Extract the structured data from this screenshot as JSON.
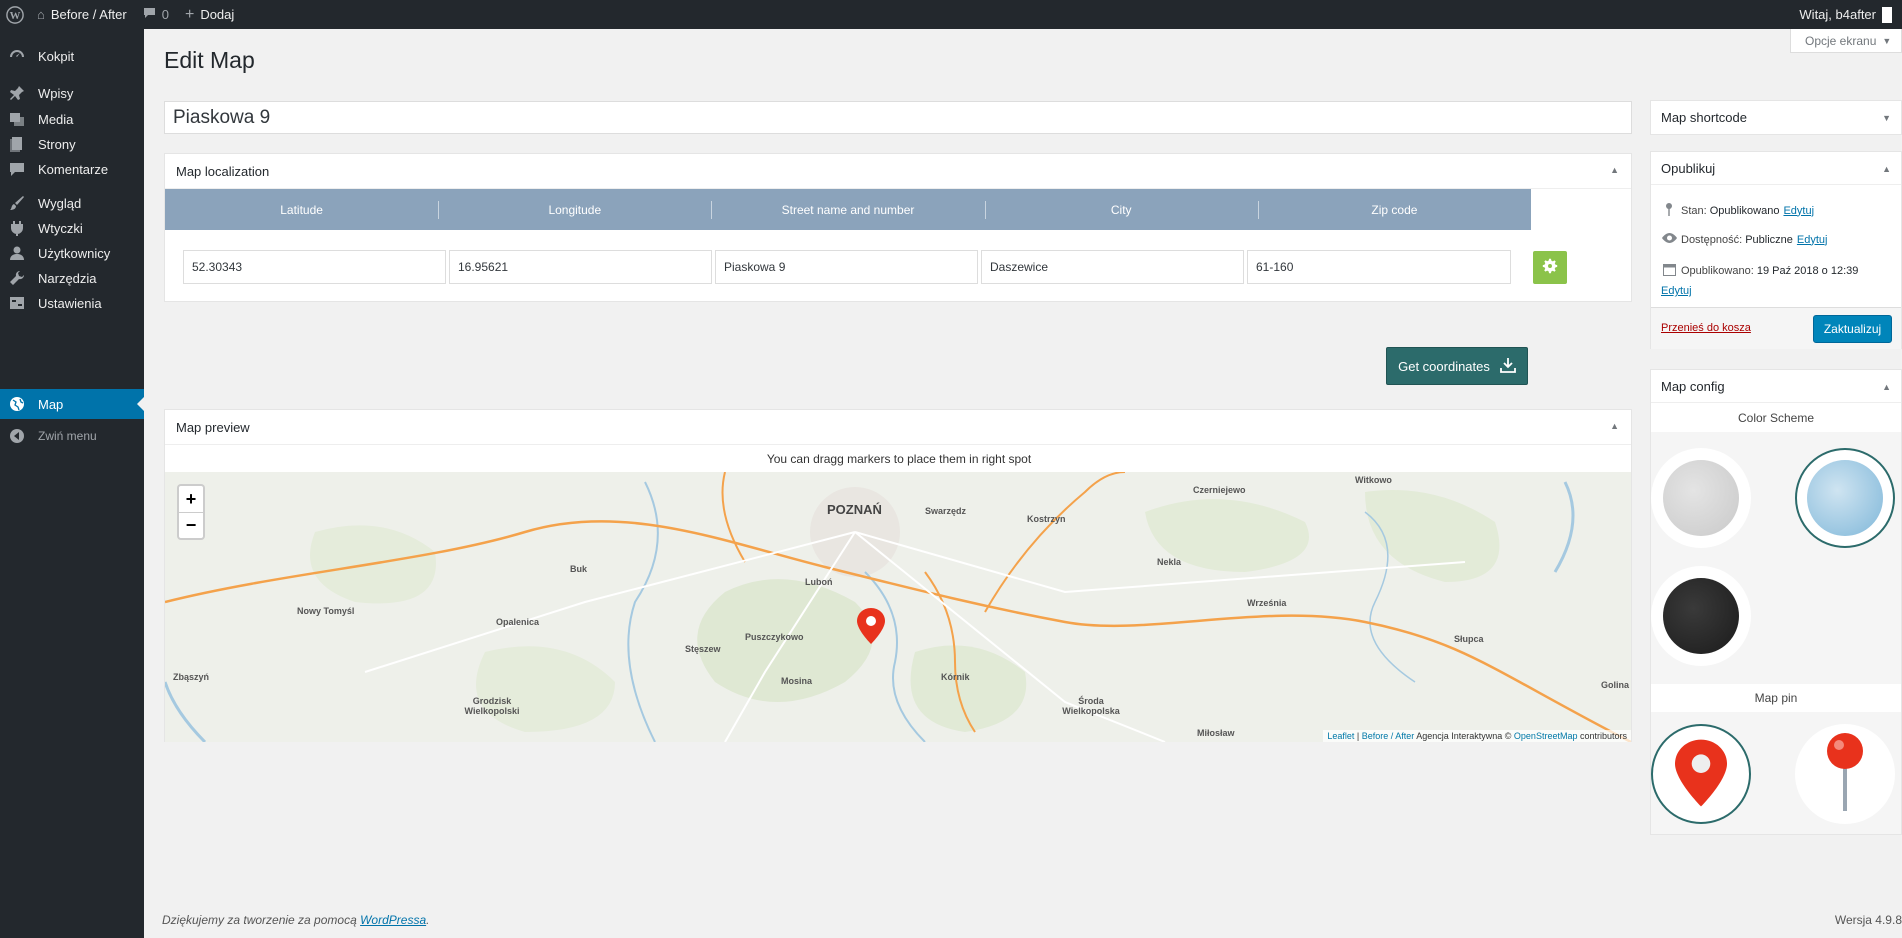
{
  "adminbar": {
    "site_name": "Before / After",
    "comments_count": "0",
    "new_label": "Dodaj",
    "greeting": "Witaj, b4after"
  },
  "menu": {
    "items": [
      {
        "label": "Kokpit",
        "icon": "dashboard-icon"
      },
      {
        "label": "Wpisy",
        "icon": "pin-icon"
      },
      {
        "label": "Media",
        "icon": "media-icon"
      },
      {
        "label": "Strony",
        "icon": "pages-icon"
      },
      {
        "label": "Komentarze",
        "icon": "comment-icon"
      },
      {
        "label": "Wygląd",
        "icon": "brush-icon"
      },
      {
        "label": "Wtyczki",
        "icon": "plugin-icon"
      },
      {
        "label": "Użytkownicy",
        "icon": "users-icon"
      },
      {
        "label": "Narzędzia",
        "icon": "wrench-icon"
      },
      {
        "label": "Ustawienia",
        "icon": "settings-icon"
      },
      {
        "label": "Map",
        "icon": "globe-icon",
        "current": true
      },
      {
        "label": "Zwiń menu",
        "icon": "collapse-icon"
      }
    ]
  },
  "screen_options_label": "Opcje ekranu",
  "page_title": "Edit Map",
  "post_title": "Piaskowa 9",
  "localization": {
    "title": "Map localization",
    "columns": [
      "Latitude",
      "Longitude",
      "Street name and number",
      "City",
      "Zip code"
    ],
    "values": [
      "52.30343",
      "16.95621",
      "Piaskowa 9",
      "Daszewice",
      "61-160"
    ]
  },
  "get_coordinates_label": "Get coordinates",
  "preview": {
    "title": "Map preview",
    "hint": "You can dragg markers to place them in right spot",
    "labels": {
      "poznan": "POZNAŃ",
      "swarzedz": "Swarzędz",
      "kostrzyn": "Kostrzyn",
      "czerniejewo": "Czerniejewo",
      "witkowo": "Witkowo",
      "buk": "Buk",
      "nowy_tomysl": "Nowy Tomyśl",
      "opalenica": "Opalenica",
      "lubon": "Luboń",
      "nekla": "Nekla",
      "wrzesnia": "Września",
      "slupca": "Słupca",
      "puszczykowo": "Puszczykowo",
      "stesze": "Stęszew",
      "zbaszyn": "Zbąszyń",
      "mosina": "Mosina",
      "kornik": "Kórnik",
      "grodzisk": "Grodzisk Wielkopolski",
      "sroda": "Środa Wielkopolska",
      "miloslaw": "Miłosław",
      "golina": "Golina"
    },
    "attribution": {
      "leaflet": "Leaflet",
      "sep": " | ",
      "before_after": "Before / After",
      "agency": " Agencja Interaktywna © ",
      "osm": "OpenStreetMap",
      "contributors": " contributors"
    },
    "zoom_in": "+",
    "zoom_out": "−"
  },
  "sidebar": {
    "shortcode_title": "Map shortcode",
    "publish": {
      "title": "Opublikuj",
      "status_label": "Stan:",
      "status_value": "Opublikowano",
      "visibility_label": "Dostępność:",
      "visibility_value": "Publiczne",
      "published_label": "Opublikowano:",
      "published_value": "19 Paź 2018 o 12:39",
      "edit_label": "Edytuj",
      "trash_label": "Przenieś do kosza",
      "update_label": "Zaktualizuj"
    },
    "config": {
      "title": "Map config",
      "color_scheme_label": "Color Scheme",
      "map_pin_label": "Map pin"
    }
  },
  "footer": {
    "thanks_prefix": "Dziękujemy za tworzenie za pomocą ",
    "wordpress": "WordPressa",
    "thanks_suffix": ".",
    "version": "Wersja 4.9.8"
  },
  "colors": {
    "accent": "#0073aa",
    "table_header": "#8ba3bb",
    "gear_green": "#8bc34a",
    "coords_button": "#2c6b6b",
    "road": "#f4a24b",
    "pin_red": "#e8321c"
  }
}
